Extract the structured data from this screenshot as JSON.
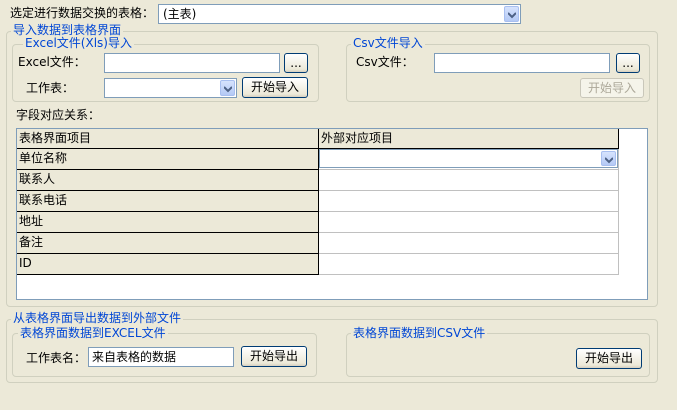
{
  "top": {
    "table_label": "选定进行数据交换的表格：",
    "table_value": "(主表)"
  },
  "import_group": {
    "title": "导入数据到表格界面",
    "excel": {
      "title": "Excel文件(Xls)导入",
      "file_label": "Excel文件：",
      "file_value": "",
      "browse_label": "...",
      "sheet_label": "工作表：",
      "sheet_value": "",
      "import_button": "开始导入"
    },
    "csv": {
      "title": "Csv文件导入",
      "file_label": "Csv文件：",
      "file_value": "",
      "browse_label": "...",
      "import_button": "开始导入"
    },
    "mapping_label": "字段对应关系：",
    "grid": {
      "headers": [
        "表格界面项目",
        "外部对应项目"
      ],
      "rows": [
        {
          "left": "单位名称",
          "right": ""
        },
        {
          "left": "联系人",
          "right": ""
        },
        {
          "left": "联系电话",
          "right": ""
        },
        {
          "left": "地址",
          "right": ""
        },
        {
          "left": "备注",
          "right": ""
        },
        {
          "left": "ID",
          "right": ""
        }
      ]
    }
  },
  "export_group": {
    "title": "从表格界面导出数据到外部文件",
    "excel": {
      "title": "表格界面数据到EXCEL文件",
      "sheet_label": "工作表名：",
      "sheet_value": "来自表格的数据",
      "export_button": "开始导出"
    },
    "csv": {
      "title": "表格界面数据到CSV文件",
      "export_button": "开始导出"
    }
  }
}
